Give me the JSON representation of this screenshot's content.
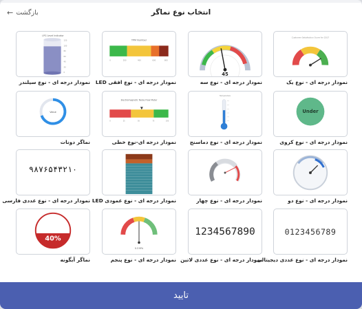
{
  "dialog": {
    "title": "انتخاب نوع نماگر",
    "back_label": "بازگشت",
    "confirm_label": "تایید"
  },
  "cards": [
    {
      "label": "نمودار درجه ای - نوع یک",
      "icon": "gauge-semicircle-chart-icon"
    },
    {
      "label": "نمودار درجه ای - نوع سه",
      "icon": "gauge-speedometer-chart-icon",
      "value_text": "45"
    },
    {
      "label": "نمودار درجه ای - نوع افقی LED",
      "icon": "horizontal-led-chart-icon",
      "chart_title": "TPM Number"
    },
    {
      "label": "نمودار درجه ای - نوع سیلندر",
      "icon": "cylinder-chart-icon",
      "chart_title": "LPG Level Indicator",
      "ticks": [
        "120",
        "100",
        "80",
        "60",
        "40",
        "20",
        "0"
      ]
    },
    {
      "label": "نمودار درجه ای - نوع کروی",
      "icon": "circle-chart-icon",
      "value_text": "Under"
    },
    {
      "label": "نمودار درجه ای - نوع دماسنج",
      "icon": "thermometer-chart-icon"
    },
    {
      "label": "نمودار درجه ای-نوع خطی",
      "icon": "linear-gauge-chart-icon",
      "chart_title": "Electromagnetic Noise Flow Meter"
    },
    {
      "label": "نماگر دونات",
      "icon": "donut-chart-icon",
      "value_text": "Value"
    },
    {
      "label": "نمودار درجه ای - نوع دو",
      "icon": "gauge-dial-chart-icon"
    },
    {
      "label": "نمودار درجه ای - نوع چهار",
      "icon": "gauge-arc-chart-icon"
    },
    {
      "label": "نمودار درجه ای - نوع عمودی LED",
      "icon": "vertical-led-chart-icon"
    },
    {
      "label": "نمودار درجه ای - نوع عددی فارسی",
      "icon": "persian-digits-chart-icon",
      "value_text": "۹۸۷۶۵۴۳۲۱۰"
    },
    {
      "label": "نمودار درجه ای - نوع عددی دیجیتالی",
      "icon": "digital-digits-chart-icon",
      "value_text": "0123456789"
    },
    {
      "label": "نمودار درجه ای - نوع عددی لاتین",
      "icon": "latin-digits-chart-icon",
      "value_text": "1234567890"
    },
    {
      "label": "نمودار درجه ای - نوع پنجم",
      "icon": "gauge-bullet-chart-icon",
      "value_text": "0.3 M%"
    },
    {
      "label": "نماگر آبگونه",
      "icon": "liquid-fill-chart-icon",
      "value_text": "40%"
    }
  ]
}
